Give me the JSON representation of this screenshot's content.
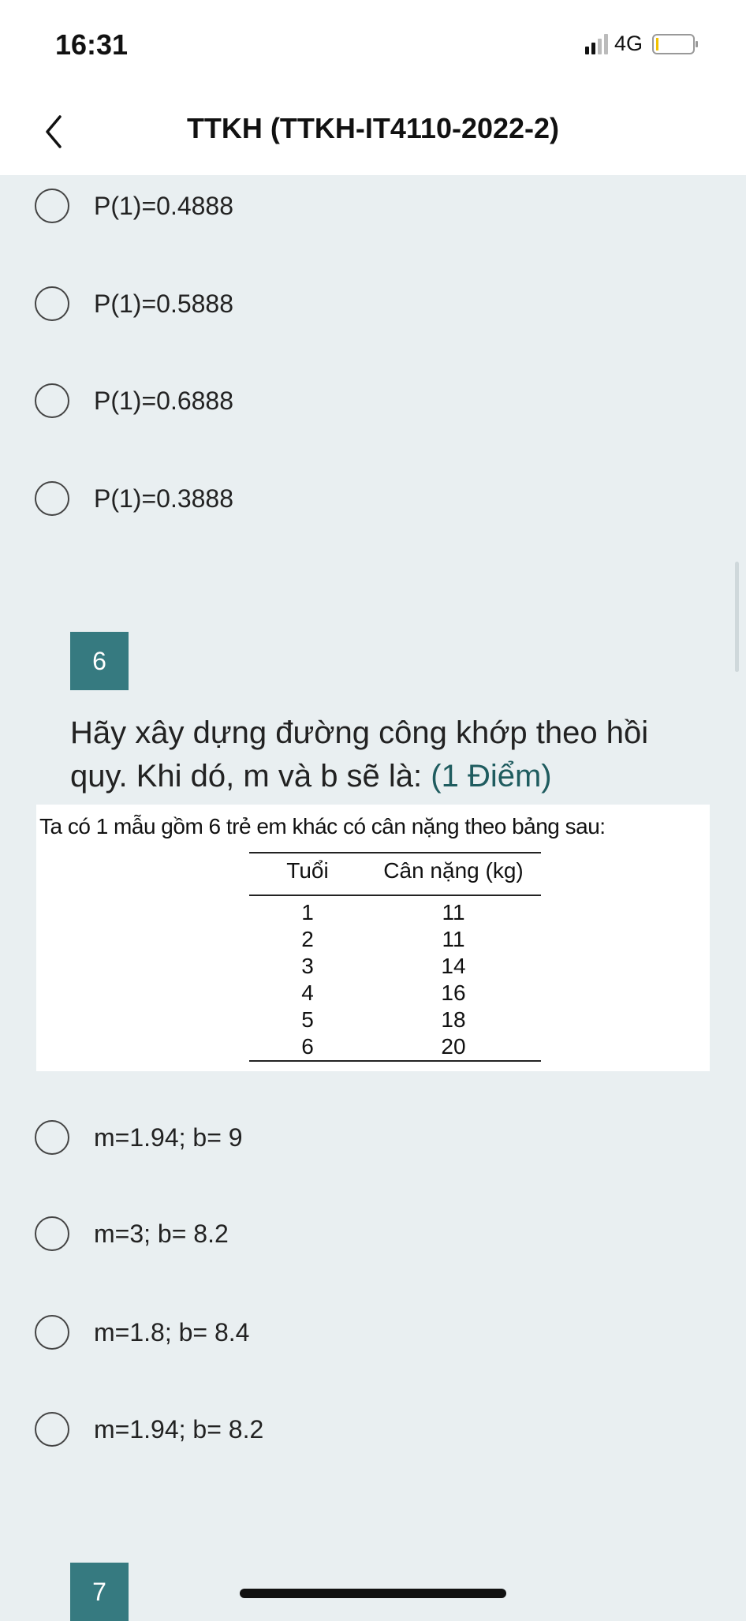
{
  "status_bar": {
    "time": "16:31",
    "network": "4G",
    "battery_color": "#f2c200"
  },
  "header": {
    "title": "TTKH (TTKH-IT4110-2022-2)",
    "back_icon": "chevron-left-icon"
  },
  "prev_question": {
    "options": [
      "P(1)=0.4888",
      "P(1)=0.5888",
      "P(1)=0.6888",
      "P(1)=0.3888"
    ]
  },
  "question6": {
    "number": "6",
    "text": "Hãy xây dựng đường công khớp theo hồi quy. Khi dó, m và b sẽ là:",
    "points": "(1 Điểm)",
    "image": {
      "intro": "Ta có 1 mẫu gồm 6 trẻ em khác có cân nặng theo bảng sau:",
      "columns": [
        "Tuổi",
        "Cân nặng (kg)"
      ],
      "rows": [
        [
          "1",
          "11"
        ],
        [
          "2",
          "11"
        ],
        [
          "3",
          "14"
        ],
        [
          "4",
          "16"
        ],
        [
          "5",
          "18"
        ],
        [
          "6",
          "20"
        ]
      ]
    },
    "options": [
      "m=1.94; b= 9",
      "m=3; b= 8.2",
      "m=1.8; b= 8.4",
      "m=1.94; b= 8.2"
    ]
  },
  "question7": {
    "number": "7"
  },
  "colors": {
    "badge": "#367a80",
    "points": "#1f5c5f",
    "background": "#e9eff1"
  }
}
